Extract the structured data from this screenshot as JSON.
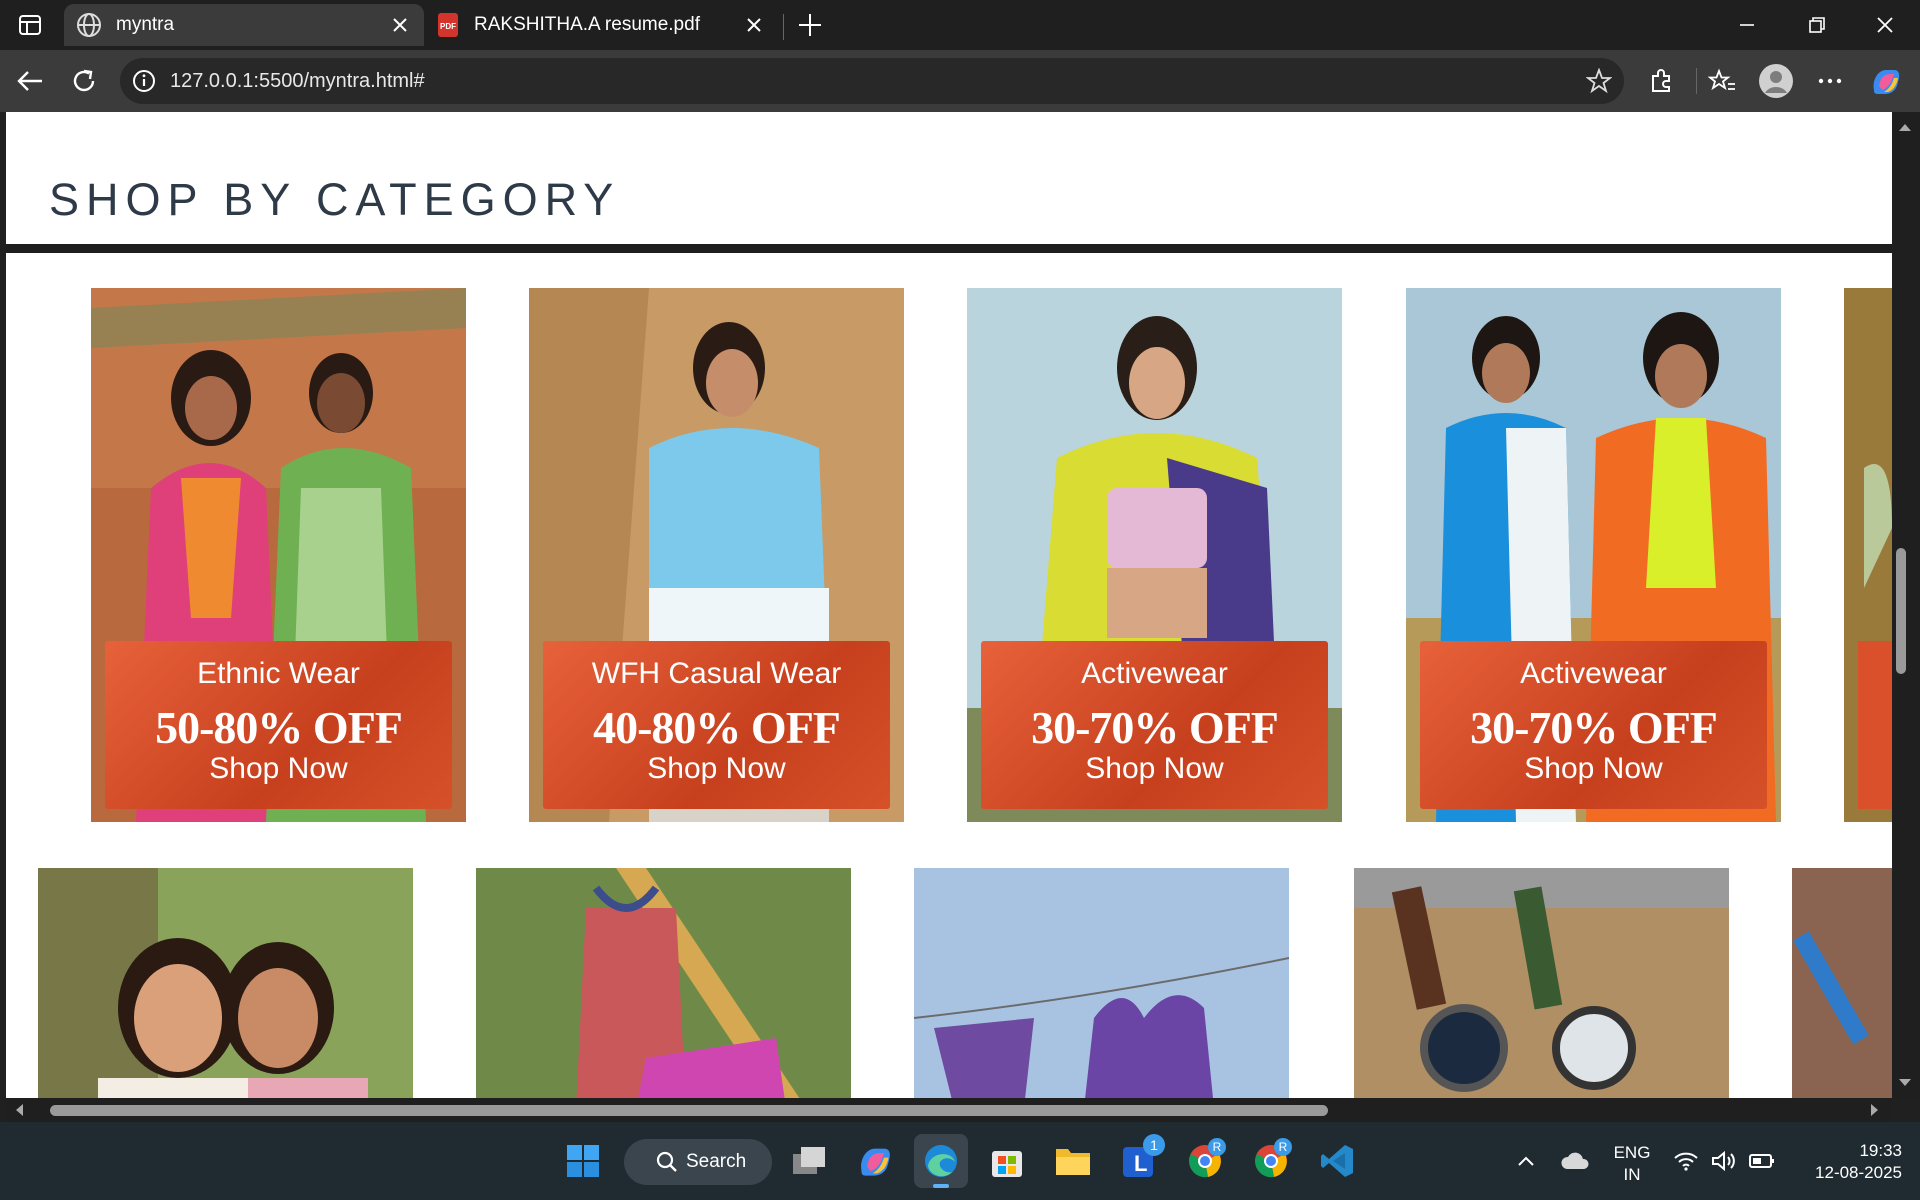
{
  "browser": {
    "tabs": [
      {
        "title": "myntra",
        "active": true
      },
      {
        "title": "RAKSHITHA.A resume.pdf",
        "active": false
      }
    ],
    "url": "127.0.0.1:5500/myntra.html#"
  },
  "page": {
    "section_title": "SHOP BY CATEGORY",
    "categories": [
      {
        "name": "Ethnic Wear",
        "offer": "50-80% OFF",
        "cta": "Shop Now"
      },
      {
        "name": "WFH Casual Wear",
        "offer": "40-80% OFF",
        "cta": "Shop Now"
      },
      {
        "name": "Activewear",
        "offer": "30-70% OFF",
        "cta": "Shop Now"
      },
      {
        "name": "Activewear",
        "offer": "30-70% OFF",
        "cta": "Shop Now"
      }
    ]
  },
  "taskbar": {
    "search_label": "Search",
    "language": "ENG",
    "region": "IN",
    "time": "19:33",
    "date": "12-08-2025",
    "notification_badge": "1",
    "profile_badges": [
      "R",
      "R"
    ]
  },
  "colors": {
    "banner": "#d9502a",
    "title": "#2e3a48",
    "chrome_dark": "#1f1f1f",
    "taskbar": "#202a31"
  }
}
